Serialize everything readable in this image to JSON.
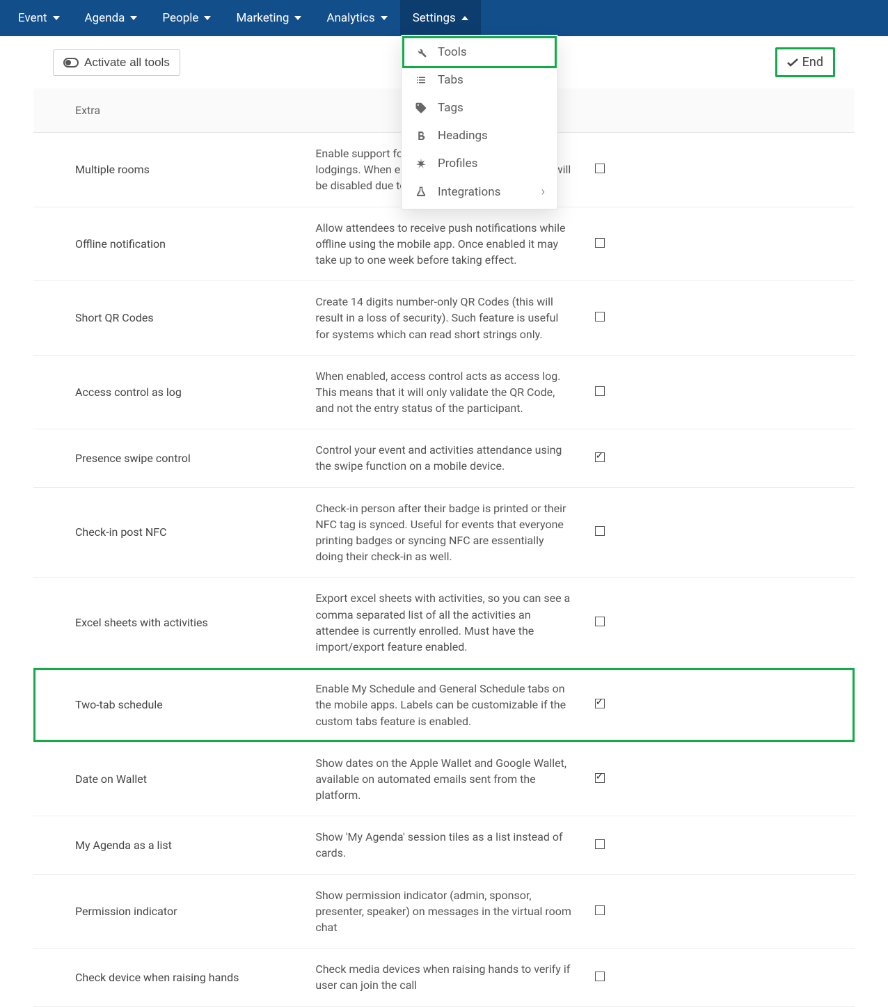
{
  "nav": {
    "items": [
      {
        "label": "Event"
      },
      {
        "label": "Agenda"
      },
      {
        "label": "People"
      },
      {
        "label": "Marketing"
      },
      {
        "label": "Analytics"
      },
      {
        "label": "Settings"
      }
    ]
  },
  "toolbar": {
    "activate_label": "Activate all tools",
    "end_label": "End"
  },
  "table": {
    "header": "Extra",
    "rows": [
      {
        "name": "Multiple rooms",
        "desc": "Enable support for a attendee to make multiple lodgings. When enabled, the mobile app lodging will be disabled due to screen space limits.",
        "checked": false
      },
      {
        "name": "Offline notification",
        "desc": "Allow attendees to receive push notifications while offline using the mobile app. Once enabled it may take up to one week before taking effect.",
        "checked": false
      },
      {
        "name": "Short QR Codes",
        "desc": "Create 14 digits number-only QR Codes (this will result in a loss of security). Such feature is useful for systems which can read short strings only.",
        "checked": false
      },
      {
        "name": "Access control as log",
        "desc": "When enabled, access control acts as access log. This means that it will only validate the QR Code, and not the entry status of the participant.",
        "checked": false
      },
      {
        "name": "Presence swipe control",
        "desc": "Control your event and activities attendance using the swipe function on a mobile device.",
        "checked": true
      },
      {
        "name": "Check-in post NFC",
        "desc": "Check-in person after their badge is printed or their NFC tag is synced. Useful for events that everyone printing badges or syncing NFC are essentially doing their check-in as well.",
        "checked": false
      },
      {
        "name": "Excel sheets with activities",
        "desc": "Export excel sheets with activities, so you can see a comma separated list of all the activities an attendee is currently enrolled. Must have the import/export feature enabled.",
        "checked": false
      },
      {
        "name": "Two-tab schedule",
        "desc": "Enable My Schedule and General Schedule tabs on the mobile apps. Labels can be customizable if the custom tabs feature is enabled.",
        "checked": true,
        "highlight": true
      },
      {
        "name": "Date on Wallet",
        "desc": "Show dates on the Apple Wallet and Google Wallet, available on automated emails sent from the platform.",
        "checked": true
      },
      {
        "name": "My Agenda as a list",
        "desc": "Show 'My Agenda' session tiles as a list instead of cards.",
        "checked": false
      },
      {
        "name": "Permission indicator",
        "desc": "Show permission indicator (admin, sponsor, presenter, speaker) on messages in the virtual room chat",
        "checked": false
      },
      {
        "name": "Check device when raising hands",
        "desc": "Check media devices when raising hands to verify if user can join the call",
        "checked": false
      }
    ]
  },
  "dropdown": {
    "items": [
      {
        "label": "Tools",
        "icon": "wrench",
        "highlight": true
      },
      {
        "label": "Tabs",
        "icon": "list"
      },
      {
        "label": "Tags",
        "icon": "tag"
      },
      {
        "label": "Headings",
        "icon": "bold"
      },
      {
        "label": "Profiles",
        "icon": "asterisk"
      },
      {
        "label": "Integrations",
        "icon": "flask",
        "submenu": true
      }
    ]
  }
}
